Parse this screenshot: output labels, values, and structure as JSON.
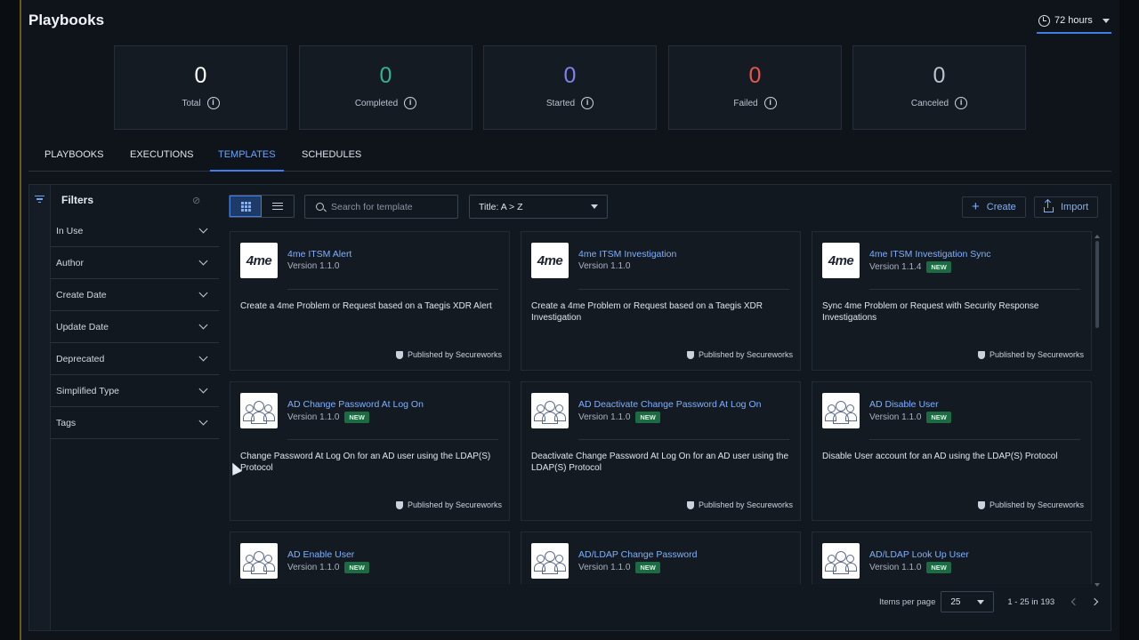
{
  "header": {
    "title": "Playbooks",
    "time_range": "72 hours"
  },
  "stats": [
    {
      "value": "0",
      "label": "Total",
      "color": "#ffffff"
    },
    {
      "value": "0",
      "label": "Completed",
      "color": "#2fb58f"
    },
    {
      "value": "0",
      "label": "Started",
      "color": "#7c82ee"
    },
    {
      "value": "0",
      "label": "Failed",
      "color": "#e8574d"
    },
    {
      "value": "0",
      "label": "Canceled",
      "color": "#b9c2ce"
    }
  ],
  "tabs": [
    "PLAYBOOKS",
    "EXECUTIONS",
    "TEMPLATES",
    "SCHEDULES"
  ],
  "active_tab": "TEMPLATES",
  "filters": {
    "title": "Filters",
    "items": [
      "In Use",
      "Author",
      "Create Date",
      "Update Date",
      "Deprecated",
      "Simplified Type",
      "Tags"
    ]
  },
  "toolbar": {
    "search_placeholder": "Search for template",
    "sort_value": "Title: A > Z",
    "create_label": "Create",
    "import_label": "Import"
  },
  "cards": [
    {
      "title": "4me ITSM Alert",
      "version": "Version  1.1.0",
      "is_new": false,
      "logo": "4me",
      "description": "Create a 4me Problem or Request based on a Taegis XDR Alert",
      "publisher": "Published by Secureworks"
    },
    {
      "title": "4me ITSM Investigation",
      "version": "Version  1.1.0",
      "is_new": false,
      "logo": "4me",
      "description": "Create a 4me Problem or Request based on a Taegis XDR Investigation",
      "publisher": "Published by Secureworks"
    },
    {
      "title": "4me ITSM Investigation Sync",
      "version": "Version  1.1.4",
      "is_new": true,
      "logo": "4me",
      "description": "Sync 4me Problem or Request with Security Response Investigations",
      "publisher": "Published by Secureworks"
    },
    {
      "title": "AD Change Password At Log On",
      "version": "Version  1.1.0",
      "is_new": true,
      "logo": "people",
      "description": "Change Password At Log On for an AD user using the LDAP(S) Protocol",
      "publisher": "Published by Secureworks"
    },
    {
      "title": "AD Deactivate Change Password At Log On",
      "version": "Version  1.1.0",
      "is_new": true,
      "logo": "people",
      "description": "Deactivate Change Password At Log On for an AD user using the LDAP(S) Protocol",
      "publisher": "Published by Secureworks"
    },
    {
      "title": "AD Disable User",
      "version": "Version  1.1.0",
      "is_new": true,
      "logo": "people",
      "description": "Disable User account for an AD using the LDAP(S) Protocol",
      "publisher": "Published by Secureworks"
    },
    {
      "title": "AD Enable User",
      "version": "Version  1.1.0",
      "is_new": true,
      "logo": "people",
      "description": "",
      "publisher": ""
    },
    {
      "title": "AD/LDAP Change Password",
      "version": "Version  1.1.0",
      "is_new": true,
      "logo": "people",
      "description": "",
      "publisher": ""
    },
    {
      "title": "AD/LDAP Look Up User",
      "version": "Version  1.1.0",
      "is_new": true,
      "logo": "people",
      "description": "",
      "publisher": ""
    }
  ],
  "new_badge": "NEW",
  "pagination": {
    "items_per_page_label": "Items per page",
    "per_page": "25",
    "range": "1 - 25 in 193"
  }
}
